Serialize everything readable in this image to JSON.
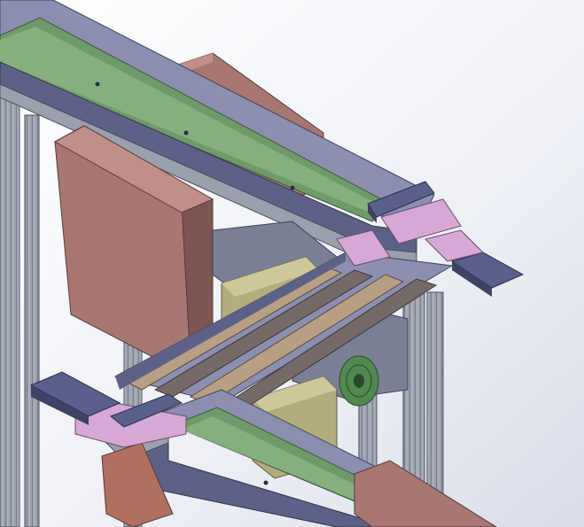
{
  "scene": {
    "description_free": true,
    "colors": {
      "background_top": "#ffffff",
      "background_bottom": "#d9dde8",
      "frame_aluminum": "#9aa0ad",
      "frame_dark": "#5a6070",
      "conveyor_rail": "#8c8fb0",
      "conveyor_rail_dark": "#5e6187",
      "belt_green": "#6f9a6a",
      "belt_green_light": "#85b07e",
      "cabinet_brown": "#a87772",
      "cabinet_brown_dark": "#7d5553",
      "motor_olive": "#b3ad7e",
      "transfer_belt_tan": "#b89f84",
      "transfer_belt_dark": "#766a69",
      "bracket_pink": "#d7a8d5",
      "block_purple": "#5a5f8c",
      "fan_green": "#4f8a4f"
    }
  }
}
